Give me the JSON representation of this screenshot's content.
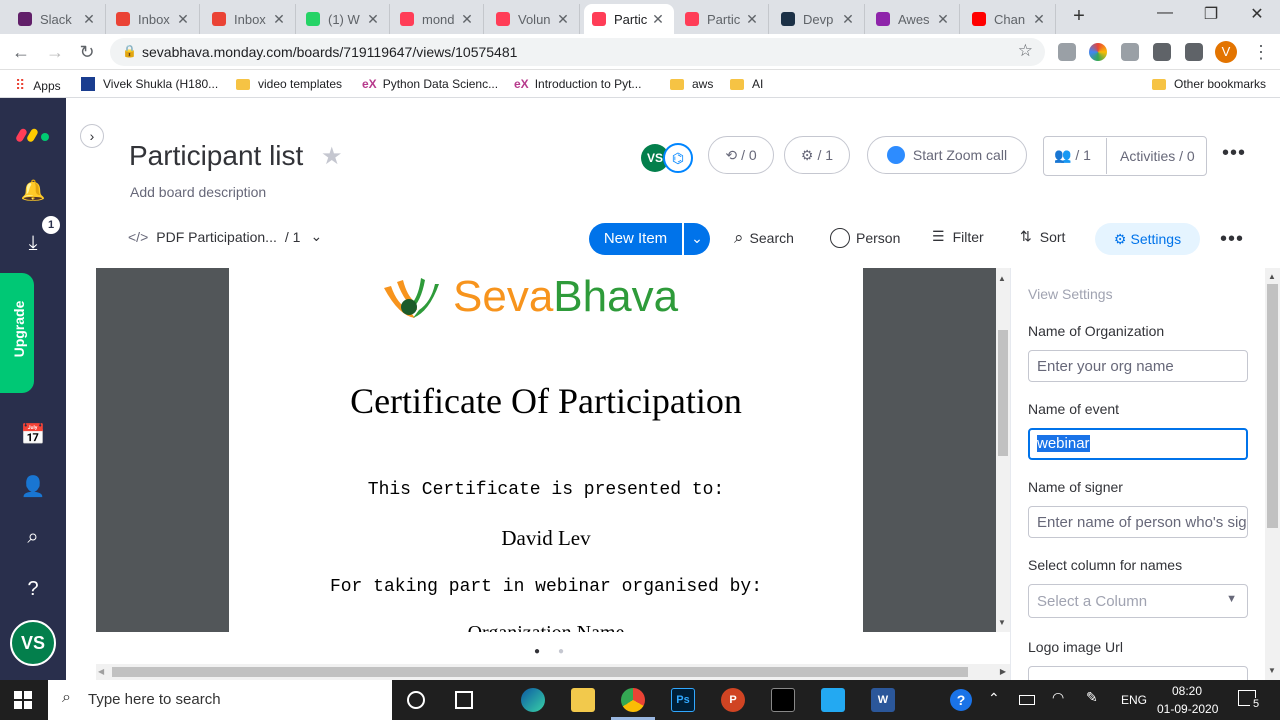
{
  "browser": {
    "tabs": [
      {
        "label": "Slack",
        "color": "#611f69"
      },
      {
        "label": "Inbox",
        "color": "#ea4335"
      },
      {
        "label": "Inbox",
        "color": "#ea4335"
      },
      {
        "label": "(1) W",
        "color": "#25d366"
      },
      {
        "label": "mond",
        "color": "#ff3d57"
      },
      {
        "label": "Volun",
        "color": "#ff3d57"
      },
      {
        "label": "Partic",
        "color": "#ff3d57"
      },
      {
        "label": "Partic",
        "color": "#ff3d57"
      },
      {
        "label": "Devp",
        "color": "#1b3046"
      },
      {
        "label": "Awes",
        "color": "#8e24aa"
      },
      {
        "label": "Chan",
        "color": "#ff0000"
      }
    ],
    "url": "sevabhava.monday.com/boards/719119647/views/10575481",
    "profile_initial": "V",
    "bookmarks": [
      "Apps",
      "Vivek Shukla (H180...",
      "video templates",
      "Python Data Scienc...",
      "Introduction to Pyt...",
      "aws",
      "AI",
      "Other bookmarks"
    ]
  },
  "rail": {
    "notification_count": "1",
    "upgrade_label": "Upgrade",
    "avatar": "VS"
  },
  "board": {
    "title": "Participant list",
    "description": "Add board description",
    "avatar": "VS",
    "updates": "/ 0",
    "integrations": "/ 1",
    "zoom_label": "Start Zoom call",
    "members": "/ 1",
    "activities": "Activities / 0"
  },
  "toolbar": {
    "view_label": "PDF Participation...",
    "view_count": "/ 1",
    "new_item": "New Item",
    "search": "Search",
    "person": "Person",
    "filter": "Filter",
    "sort": "Sort",
    "settings": "Settings"
  },
  "certificate": {
    "logo_seva": "Seva",
    "logo_bhava": "Bhava",
    "title": "Certificate Of Participation",
    "presented": "This Certificate is presented to:",
    "name": "David Lev",
    "taking_part": "For taking part in webinar organised by:",
    "org": "Organization Name"
  },
  "settings_panel": {
    "heading": "View Settings",
    "org_label": "Name of Organization",
    "org_placeholder": "Enter your org name",
    "event_label": "Name of event",
    "event_value": "webinar",
    "signer_label": "Name of signer",
    "signer_placeholder": "Enter name of person who's sig",
    "column_label": "Select column for names",
    "column_placeholder": "Select a Column",
    "logo_label": "Logo image Url"
  },
  "taskbar": {
    "search_placeholder": "Type here to search",
    "lang": "ENG",
    "time": "08:20",
    "date": "01-09-2020",
    "notif": "5"
  }
}
